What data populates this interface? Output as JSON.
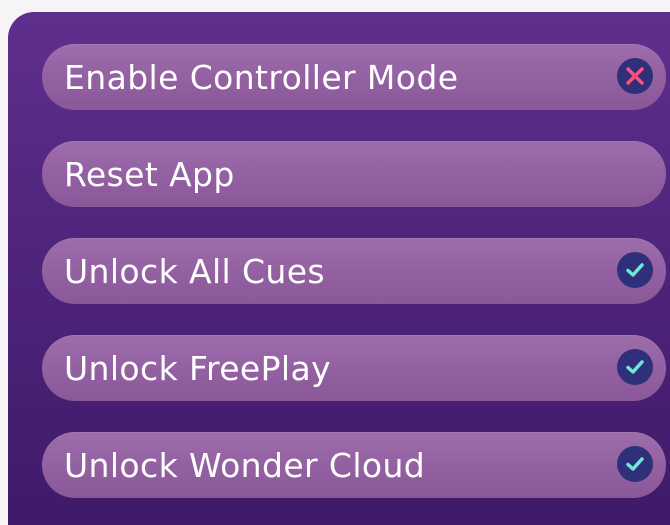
{
  "settings": {
    "items": [
      {
        "label": "Enable Controller Mode",
        "status": "disabled",
        "icon": "close-icon",
        "icon_color": "#ff4f7a"
      },
      {
        "label": "Reset App",
        "status": "none",
        "icon": ""
      },
      {
        "label": "Unlock All Cues",
        "status": "enabled",
        "icon": "check-icon",
        "icon_color": "#6fe6d6"
      },
      {
        "label": "Unlock FreePlay",
        "status": "enabled",
        "icon": "check-icon",
        "icon_color": "#6fe6d6"
      },
      {
        "label": "Unlock Wonder Cloud",
        "status": "enabled",
        "icon": "check-icon",
        "icon_color": "#6fe6d6"
      }
    ]
  },
  "colors": {
    "panel": "#4c2379",
    "pill": "#9462a2",
    "status_circle": "#2f2f7a"
  }
}
